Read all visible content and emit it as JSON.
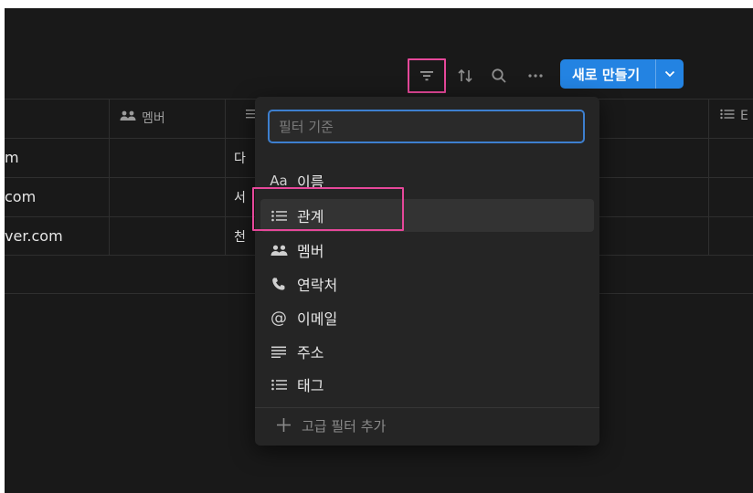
{
  "toolbar": {
    "filter_icon": "filter-icon",
    "sort_icon": "sort-icon",
    "search_icon": "search-icon",
    "more_icon": "more-icon",
    "new_button_label": "새로 만들기",
    "accent": "#2383e2",
    "highlight": "#e6489a"
  },
  "table": {
    "headers": [
      {
        "icon": "people-icon",
        "label": "멤버"
      },
      {
        "icon": "text-icon",
        "label": ""
      },
      {
        "icon": "list-icon",
        "label": "E"
      }
    ],
    "rows": [
      {
        "email": "m",
        "second": "다"
      },
      {
        "email": "com",
        "second": "서"
      },
      {
        "email": "ver.com",
        "second": "천"
      }
    ]
  },
  "filter_menu": {
    "placeholder": "필터 기준",
    "items": [
      {
        "icon": "Aa",
        "label": "이름"
      },
      {
        "icon": "list-icon",
        "label": "관계",
        "highlighted": true
      },
      {
        "icon": "people-icon",
        "label": "멤버"
      },
      {
        "icon": "phone-icon",
        "label": "연락처"
      },
      {
        "icon": "@",
        "label": "이메일"
      },
      {
        "icon": "text-lines-icon",
        "label": "주소"
      },
      {
        "icon": "list-icon",
        "label": "태그"
      }
    ],
    "advanced": "고급 필터 추가"
  }
}
